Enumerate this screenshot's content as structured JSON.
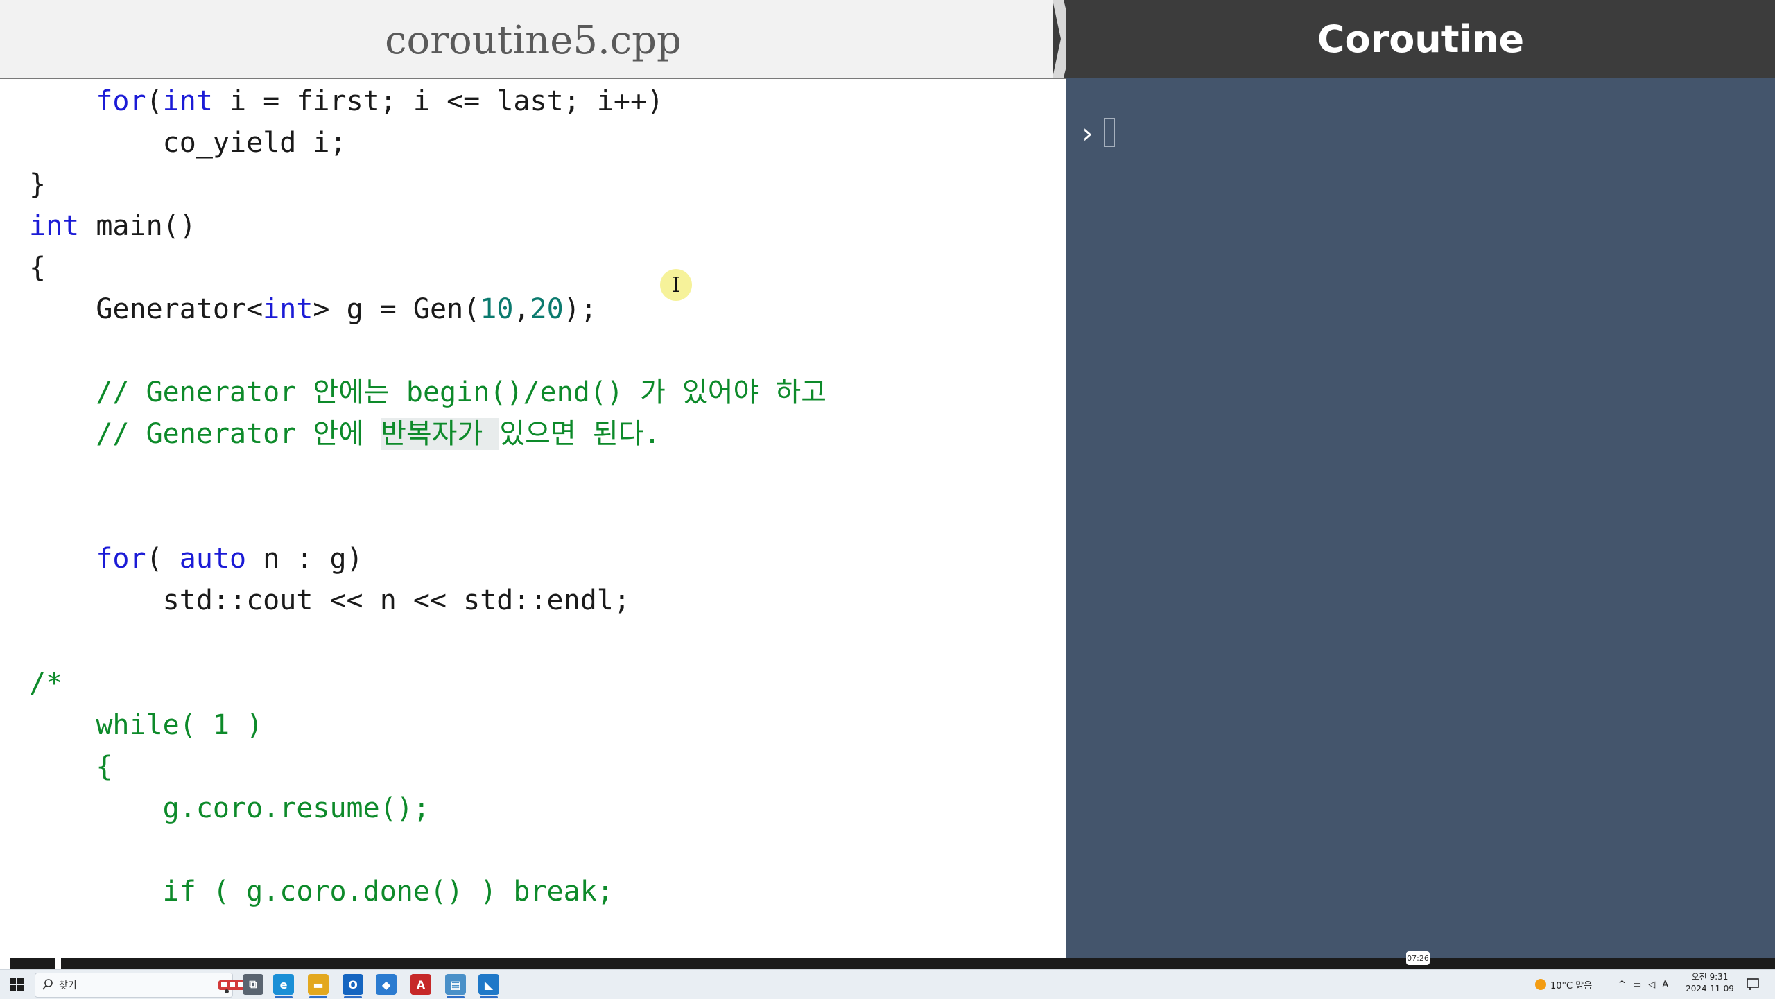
{
  "editor": {
    "tab_title": "coroutine5.cpp",
    "lines": [
      {
        "indent": "    ",
        "segments": [
          {
            "t": "for",
            "c": "kw"
          },
          {
            "t": "(",
            "c": ""
          },
          {
            "t": "int",
            "c": "kw"
          },
          {
            "t": " i = first; i <= last; i++)",
            "c": ""
          }
        ]
      },
      {
        "indent": "        ",
        "segments": [
          {
            "t": "co_yield i;",
            "c": ""
          }
        ]
      },
      {
        "indent": "",
        "segments": [
          {
            "t": "}",
            "c": ""
          }
        ]
      },
      {
        "indent": "",
        "segments": [
          {
            "t": "int",
            "c": "kw"
          },
          {
            "t": " main()",
            "c": ""
          }
        ]
      },
      {
        "indent": "",
        "segments": [
          {
            "t": "{",
            "c": ""
          }
        ]
      },
      {
        "indent": "    ",
        "segments": [
          {
            "t": "Generator<",
            "c": ""
          },
          {
            "t": "int",
            "c": "kw"
          },
          {
            "t": "> g = Gen(",
            "c": ""
          },
          {
            "t": "10",
            "c": "num"
          },
          {
            "t": ",",
            "c": ""
          },
          {
            "t": "20",
            "c": "num"
          },
          {
            "t": ");",
            "c": ""
          }
        ]
      },
      {
        "indent": "",
        "segments": []
      },
      {
        "indent": "    ",
        "segments": [
          {
            "t": "// Generator 안에는 begin()/end() 가 있어야 하고",
            "c": "cm"
          }
        ]
      },
      {
        "indent": "    ",
        "segments": [
          {
            "t": "// Generator 안에 ",
            "c": "cm"
          },
          {
            "t": "반복자가 ",
            "c": "cm hl"
          },
          {
            "t": "있으면 된다.",
            "c": "cm"
          }
        ]
      },
      {
        "indent": "",
        "segments": []
      },
      {
        "indent": "",
        "segments": []
      },
      {
        "indent": "    ",
        "segments": [
          {
            "t": "for",
            "c": "kw"
          },
          {
            "t": "( ",
            "c": ""
          },
          {
            "t": "auto",
            "c": "kw"
          },
          {
            "t": " n : g)",
            "c": ""
          }
        ]
      },
      {
        "indent": "        ",
        "segments": [
          {
            "t": "std::cout << n << std::endl;",
            "c": ""
          }
        ]
      },
      {
        "indent": "",
        "segments": []
      },
      {
        "indent": "",
        "segments": [
          {
            "t": "/*",
            "c": "cm"
          }
        ]
      },
      {
        "indent": "    ",
        "segments": [
          {
            "t": "while( 1 )",
            "c": "cm"
          }
        ]
      },
      {
        "indent": "    ",
        "segments": [
          {
            "t": "{",
            "c": "cm"
          }
        ]
      },
      {
        "indent": "        ",
        "segments": [
          {
            "t": "g.coro.resume();",
            "c": "cm"
          }
        ]
      },
      {
        "indent": "",
        "segments": []
      },
      {
        "indent": "        ",
        "segments": [
          {
            "t": "if ( g.coro.done() ) break;",
            "c": "cm"
          }
        ]
      }
    ]
  },
  "terminal": {
    "title": "Coroutine",
    "prompt": "›"
  },
  "player": {
    "time_tooltip": "07:26"
  },
  "taskbar": {
    "search_placeholder": "찾기",
    "apps": [
      {
        "icon": "task-view-icon",
        "label": "⧉",
        "color": "#5a6470"
      },
      {
        "icon": "edge-icon",
        "label": "e",
        "color": "#1a8fd6"
      },
      {
        "icon": "file-explorer-icon",
        "label": "▬",
        "color": "#e3a81f"
      },
      {
        "icon": "outlook-icon",
        "label": "O",
        "color": "#1565c0"
      },
      {
        "icon": "store-icon",
        "label": "◆",
        "color": "#2b7bd0"
      },
      {
        "icon": "acrobat-icon",
        "label": "A",
        "color": "#c62828"
      },
      {
        "icon": "app-icon",
        "label": "▤",
        "color": "#4a90c8"
      },
      {
        "icon": "vscode-icon",
        "label": "◣",
        "color": "#1f78c8"
      }
    ],
    "weather": "10°C  맑음",
    "ime": "A",
    "clock_time": "오전 9:31",
    "clock_date": "2024-11-09"
  }
}
